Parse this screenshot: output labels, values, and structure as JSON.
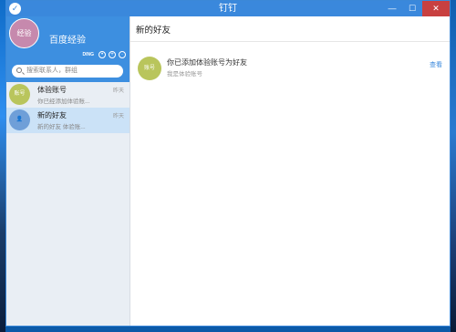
{
  "window": {
    "title": "钉钉",
    "ctrl_min": "—",
    "ctrl_max": "☐",
    "ctrl_close": "✕"
  },
  "profile": {
    "avatar_text": "经验",
    "name": "百度经验",
    "ding_label": "DING",
    "icons": [
      "person-icon",
      "plus-icon",
      "settings-icon"
    ]
  },
  "search": {
    "placeholder": "搜索联系人，群组"
  },
  "conversations": [
    {
      "avatar_text": "账号",
      "name": "体验账号",
      "preview": "你已经添加体验账...",
      "time": "昨天",
      "avatar_color": "#b9c55c"
    },
    {
      "avatar_text": "👤",
      "name": "新的好友",
      "preview": "新的好友  体验账...",
      "time": "昨天",
      "avatar_color": "#6f9fd8"
    }
  ],
  "main": {
    "title": "新的好友",
    "friend": {
      "avatar_text": "账号",
      "title": "你已添加体验账号为好友",
      "subtitle": "我是体验账号",
      "action": "查看"
    }
  }
}
